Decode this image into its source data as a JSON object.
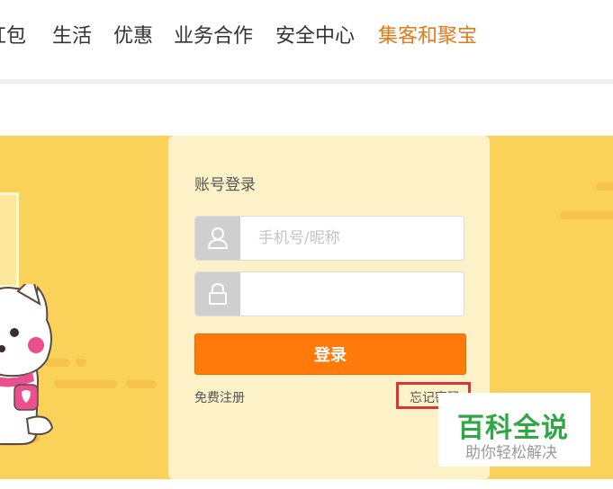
{
  "nav": {
    "items": [
      {
        "label": "红包",
        "active": false
      },
      {
        "label": "生活",
        "active": false
      },
      {
        "label": "优惠",
        "active": false
      },
      {
        "label": "业务合作",
        "active": false
      },
      {
        "label": "安全中心",
        "active": false
      },
      {
        "label": "集客和聚宝",
        "active": true
      }
    ],
    "active_color": "#e07a1c"
  },
  "login": {
    "title": "账号登录",
    "username_placeholder": "手机号/昵称",
    "username_value": "",
    "password_value": "",
    "submit_label": "登录",
    "register_link": "免费注册",
    "forgot_link": "忘记密码"
  },
  "watermark": {
    "title": "百科全说",
    "subtitle": "助你轻松解决"
  },
  "colors": {
    "banner": "#fad25a",
    "panel": "#fdf1c7",
    "button": "#ff7a0a",
    "highlight_box": "#d6363b"
  }
}
